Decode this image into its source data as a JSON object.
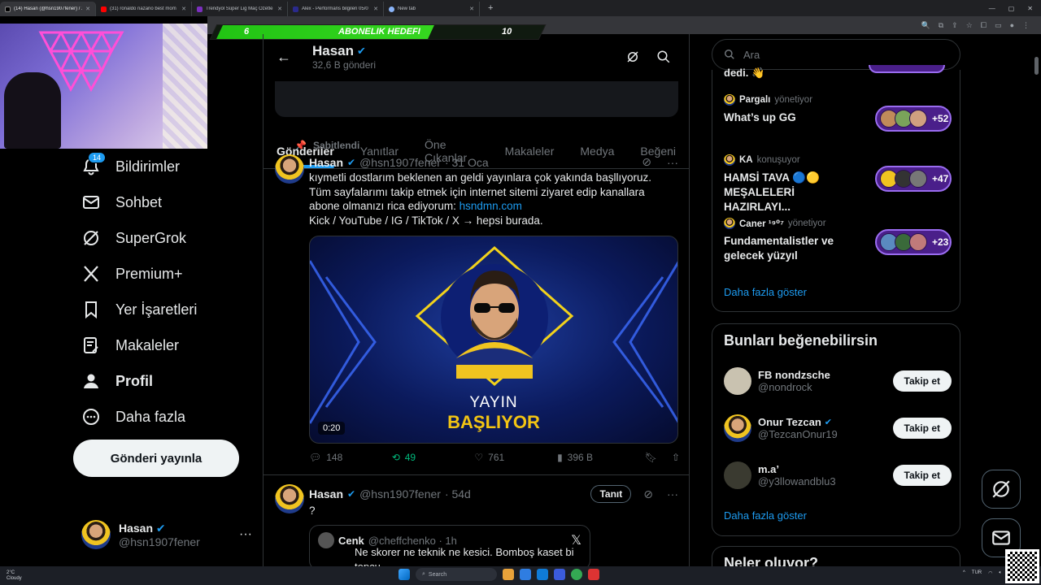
{
  "browser": {
    "tabs": [
      {
        "title": "(14) Hasan (@hsn1907fener) / X",
        "color": "#000000",
        "active": true
      },
      {
        "title": "(31) ronaldo nazario best mom",
        "color": "#ff0000"
      },
      {
        "title": "Trendyol Süper Lig Maç Özetle",
        "color": "#7b2fbe"
      },
      {
        "title": "Alex - Performans bilgileri 05/0",
        "color": "#2a2a8c"
      },
      {
        "title": "New tab",
        "color": "#8ab4f8"
      }
    ],
    "new_tab": "+"
  },
  "overlay": {
    "left": "6",
    "center": "ABONELIK HEDEFI",
    "right": "10"
  },
  "nav": {
    "items": [
      {
        "label": "Bildirimler",
        "icon": "bell-icon",
        "badge": "14"
      },
      {
        "label": "Sohbet",
        "icon": "mail-icon"
      },
      {
        "label": "SuperGrok",
        "icon": "grok-icon"
      },
      {
        "label": "Premium+",
        "icon": "x-logo-icon"
      },
      {
        "label": "Yer İşaretleri",
        "icon": "bookmark-icon"
      },
      {
        "label": "Makaleler",
        "icon": "articles-icon"
      },
      {
        "label": "Profil",
        "icon": "profile-icon"
      },
      {
        "label": "Daha fazla",
        "icon": "more-circle-icon"
      }
    ],
    "post_button": "Gönderi yayınla",
    "account": {
      "name": "Hasan",
      "handle": "@hsn1907fener",
      "more": "···"
    }
  },
  "header": {
    "name": "Hasan",
    "count": "32,6 B gönderi"
  },
  "tabs": [
    "Gönderiler",
    "Yanıtlar",
    "Öne Çıkanlar",
    "Makaleler",
    "Medya",
    "Beğeni"
  ],
  "pinned_label": "Sabitlendi",
  "post1": {
    "name": "Hasan",
    "handle": "@hsn1907fener",
    "date": "· 31 Oca",
    "line1": "kıymetli dostlarım beklenen an geldi yayınlara çok yakında başllıyoruz.",
    "line2": "Tüm sayfalarımı takip etmek için internet sitemi ziyaret edip kanallara",
    "line3_a": "abone olmanızı rica ediyorum: ",
    "link": "hsndmn.com",
    "line4": "Kick / YouTube / IG / TikTok / X → hepsi burada.",
    "media_title1": "YAYIN",
    "media_title2": "BAŞLIYOR",
    "duration": "0:20",
    "replies": "148",
    "reposts": "49",
    "likes": "761",
    "views": "396 B"
  },
  "post2": {
    "name": "Hasan",
    "handle": "@hsn1907fener",
    "date": "· 54d",
    "tanit": "Tanıt",
    "text": "?",
    "quote": {
      "name": "Cenk",
      "handle": "@cheffchenko · 1h",
      "text1": "Ne skorer ne teknik ne kesici. Bomboş kaset bi",
      "text2": "topcu"
    }
  },
  "right": {
    "search_placeholder": "Ara",
    "top_cut": "dedi.",
    "spaces": [
      {
        "host": "Pargalı",
        "role": "yönetiyor",
        "title": "What’s up GG",
        "count": "+52"
      },
      {
        "host": "KA",
        "role": "konuşuyor",
        "title": "HAMSİ TAVA 🔵🟡 MEŞALELERİ HAZIRLAYI...",
        "count": "+47"
      },
      {
        "host": "Caner ¹⁹⁰⁷",
        "role": "yönetiyor",
        "title": "Fundamentalistler ve gelecek yüzyıl",
        "count": "+23"
      }
    ],
    "show_more": "Daha fazla göster",
    "who_title": "Bunları beğenebilirsin",
    "who": [
      {
        "name": "FB nondzsche",
        "handle": "@nondrock",
        "verified": false,
        "button": "Takip et"
      },
      {
        "name": "Onur Tezcan",
        "handle": "@TezcanOnur19",
        "verified": true,
        "button": "Takip et"
      },
      {
        "name": "m.a’",
        "handle": "@y3llowandblu3",
        "verified": false,
        "button": "Takip et"
      }
    ],
    "show_more2": "Daha fazla göster",
    "trends_title": "Neler oluyor?"
  },
  "taskbar": {
    "weather_temp": "2°C",
    "weather_desc": "Cloudy",
    "search": "Search",
    "lang": "TUR"
  },
  "colors": {
    "accent": "#1d9bf0",
    "repost": "#00ba7c",
    "space": "#9a6cf0"
  }
}
